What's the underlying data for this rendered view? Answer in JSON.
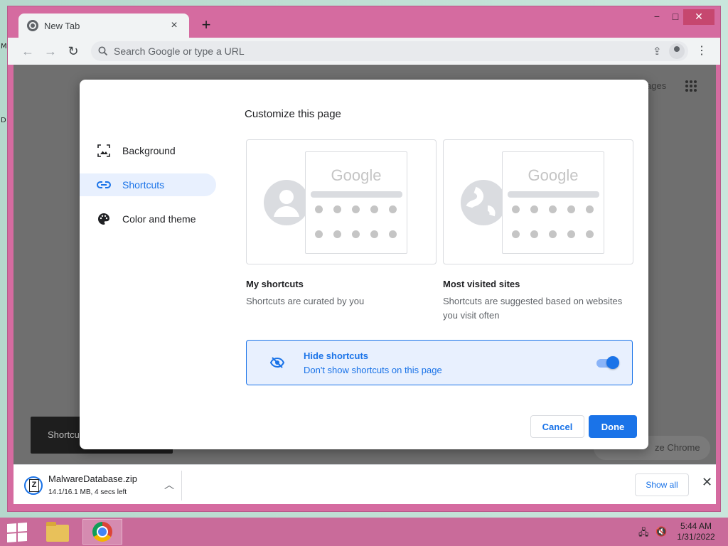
{
  "browser": {
    "tab_title": "New Tab",
    "new_tab_symbol": "+",
    "close_tab_symbol": "×",
    "window_controls": {
      "minimize": "−",
      "maximize": "□",
      "close": "✕"
    },
    "omnibox_placeholder": "Search Google or type a URL"
  },
  "page": {
    "images_link": "ages",
    "snackbar_text": "Shortcu",
    "customize_chip": "ze Chrome"
  },
  "dialog": {
    "title": "Customize this page",
    "sidebar": [
      {
        "label": "Background",
        "icon": "image-icon"
      },
      {
        "label": "Shortcuts",
        "icon": "link-icon",
        "selected": true
      },
      {
        "label": "Color and theme",
        "icon": "palette-icon"
      }
    ],
    "cards": [
      {
        "preview_logo": "Google",
        "label": "My shortcuts",
        "description": "Shortcuts are curated by you"
      },
      {
        "preview_logo": "Google",
        "label": "Most visited sites",
        "description": "Shortcuts are suggested based on websites you visit often"
      }
    ],
    "hide_shortcuts": {
      "title": "Hide shortcuts",
      "subtitle": "Don't show shortcuts on this page",
      "enabled": true
    },
    "cancel_label": "Cancel",
    "done_label": "Done"
  },
  "download_shelf": {
    "file_name": "MalwareDatabase.zip",
    "status": "14.1/16.1 MB, 4 secs left",
    "show_all_label": "Show all"
  },
  "taskbar": {
    "time": "5:44 AM",
    "date": "1/31/2022"
  },
  "colors": {
    "accent": "#1a73e8",
    "window_frame": "#d56ba0",
    "taskbar": "#c96b9a"
  }
}
